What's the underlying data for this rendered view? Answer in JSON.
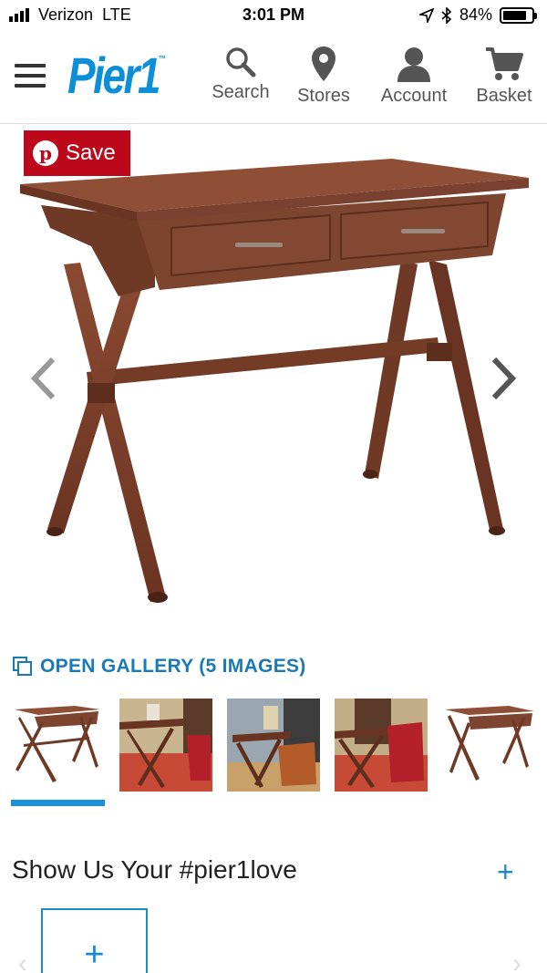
{
  "status_bar": {
    "carrier": "Verizon",
    "network": "LTE",
    "time": "3:01 PM",
    "battery_percent": "84%",
    "battery_level": 0.84
  },
  "header": {
    "logo": "Pier1",
    "logo_mark": "™",
    "nav": [
      {
        "label": "Search",
        "icon": "search-icon"
      },
      {
        "label": "Stores",
        "icon": "location-pin-icon"
      },
      {
        "label": "Account",
        "icon": "user-icon"
      },
      {
        "label": "Basket",
        "icon": "cart-icon"
      }
    ]
  },
  "product": {
    "save_label": "Save",
    "pin_glyph": "p"
  },
  "gallery": {
    "link_label": "OPEN GALLERY (5 IMAGES)",
    "thumbnails": [
      "desk-front",
      "room-scene-1",
      "room-scene-2",
      "room-scene-3",
      "desk-angle"
    ],
    "selected_index": 0
  },
  "ugc": {
    "title": "Show Us Your #pier1love",
    "expand_glyph": "+",
    "add_glyph": "+"
  },
  "colors": {
    "brand_blue": "#0d8fd8",
    "link_blue": "#1a7ab8",
    "pinterest_red": "#bd081c",
    "wood": "#7a3f2b"
  }
}
